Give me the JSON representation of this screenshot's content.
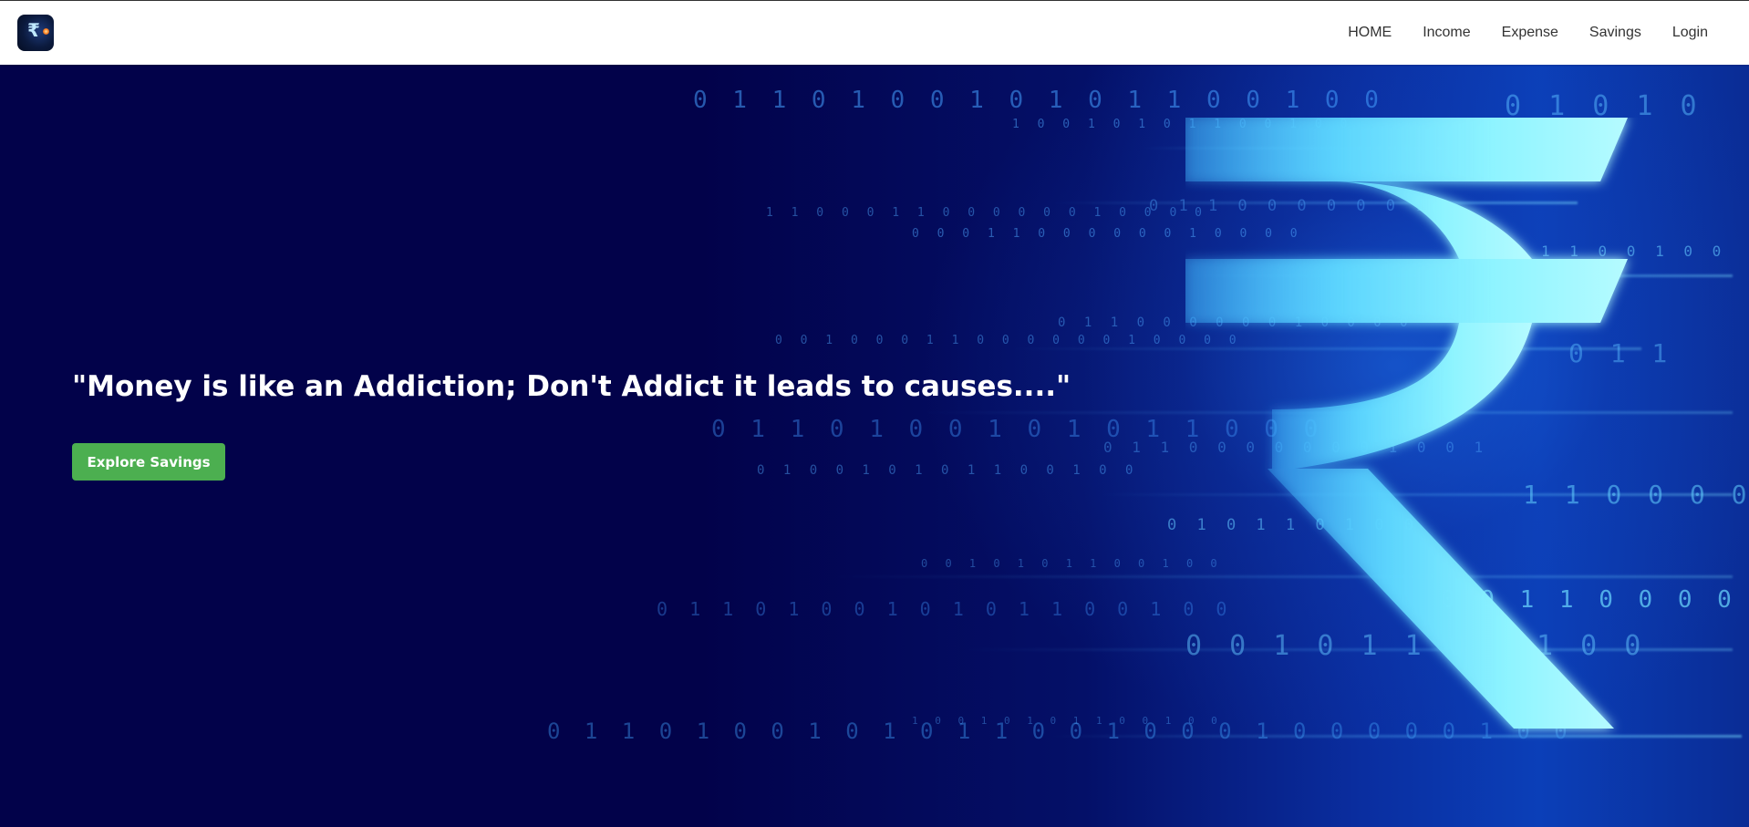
{
  "nav": {
    "logo_icon": "rupee-logo-icon",
    "links": [
      "HOME",
      "Income",
      "Expense",
      "Savings",
      "Login"
    ]
  },
  "hero": {
    "quote": "\"Money is like an Addiction; Don't Addict it leads to causes....\"",
    "button_label": "Explore Savings",
    "background_icon": "rupee-icon",
    "binary_lines": [
      "0 1 1 0 1 0 0 1 0 1 0 1 1 0 0 1 0 0",
      "1 0 0 1 0 1 0 1 1 0 0 1 0 0",
      "0 1 0 1 0",
      "1 1 0 0 0 1 1 0 0 0 0 0 0 1 0 0 0 0",
      "0 0 0 1 1 0 0 0 0 0 0 1 0 0 0 0",
      "0 1 1 0 0 0 0 0 0 1",
      "1 1 0 0 1 0 0",
      "0 0 1 0 0 0 1 1 0 0 0 0 0 0 1 0 0 0 0",
      "0 1 1 0 0 0 0 0 0 1 0 0 0 0",
      "0 1 1",
      "0 1 1 0 1 0 0 1 0 1 0 1 1 0 0 0",
      "0 1 1 0 0 0 0 0 0 0 1 0 0 1",
      "0 1 0 0 1 0 1 0 1 1 0 0 1 0 0",
      "1 1 0 0 0 0",
      "0 1 0 1 1 0 1 0 0",
      "0 0 1 0 1 0 1 1 0 0 1 0 0",
      "0 1 1 0 1 0 0 1 0 1 0 1 1 0 0 1 0 0",
      "0 0 1 1 0 0 0 0",
      "0 0 1 0 1 1 0 0 1 0 0",
      "0 1 1 0 1 0 0 1 0 1 0 1 1 0 0 1 0 0 0 1 0 0 0 0 0 1 0 0",
      "1 0 0 1 0 1 0 1 1 0 0 1 0 0"
    ]
  },
  "colors": {
    "hero_background": "#02024a",
    "button": "#4caf50",
    "rupee_glow": "#7ff0ff"
  }
}
